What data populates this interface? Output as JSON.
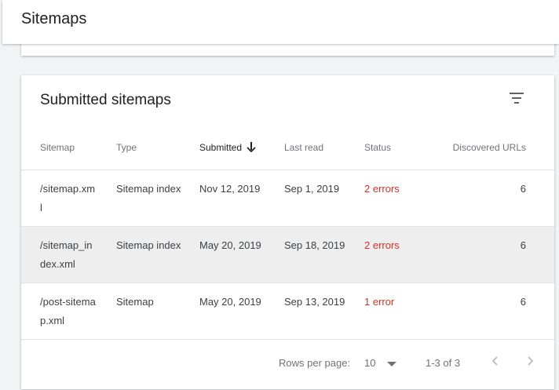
{
  "header": {
    "title": "Sitemaps"
  },
  "card": {
    "title": "Submitted sitemaps",
    "filter_icon": "filter-list-icon"
  },
  "table": {
    "columns": [
      "Sitemap",
      "Type",
      "Submitted",
      "Last read",
      "Status",
      "Discovered URLs"
    ],
    "sorted_column": "Submitted",
    "sort_direction": "descending",
    "rows": [
      {
        "sitemap": "/sitemap.xml",
        "type": "Sitemap index",
        "submitted": "Nov 12, 2019",
        "last_read": "Sep 1, 2019",
        "status": "2 errors",
        "discovered": "6"
      },
      {
        "sitemap": "/sitemap_index.xml",
        "type": "Sitemap index",
        "submitted": "May 20, 2019",
        "last_read": "Sep 18, 2019",
        "status": "2 errors",
        "discovered": "6"
      },
      {
        "sitemap": "/post-sitemap.xml",
        "type": "Sitemap",
        "submitted": "May 20, 2019",
        "last_read": "Sep 13, 2019",
        "status": "1 error",
        "discovered": "6"
      }
    ]
  },
  "pagination": {
    "rows_per_page_label": "Rows per page:",
    "rows_per_page_value": "10",
    "range": "1-3 of 3"
  },
  "colors": {
    "error": "#d93025",
    "highlight_row": "#eeeeee",
    "background": "#f1f3f4"
  }
}
